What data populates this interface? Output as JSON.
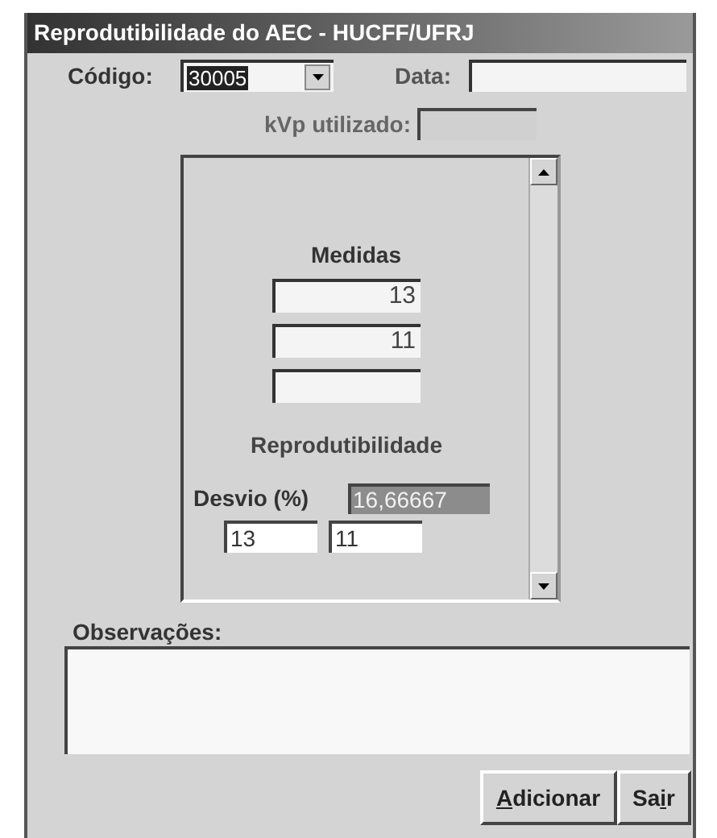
{
  "window": {
    "title": "Reprodutibilidade do AEC - HUCFF/UFRJ"
  },
  "codigo": {
    "label": "Código:",
    "value": "30005"
  },
  "data": {
    "label": "Data:"
  },
  "kvp": {
    "label": "kVp utilizado:",
    "disabled": true
  },
  "medidas": {
    "title": "Medidas",
    "values": [
      "13",
      "11"
    ]
  },
  "reprodutibilidade": {
    "title": "Reprodutibilidade",
    "desvio_label": "Desvio (%)",
    "desvio_value": "16,66667",
    "desvio_disabled": true,
    "pair": [
      "13",
      "11"
    ]
  },
  "observacoes": {
    "label": "Observações:"
  },
  "buttons": [
    {
      "label_parts": [
        {
          "text": "A",
          "underlined": true
        },
        {
          "text": "dicionar",
          "underlined": false
        }
      ]
    },
    {
      "label_parts": [
        {
          "text": "Sa",
          "underlined": false
        },
        {
          "text": "i",
          "underlined": true
        },
        {
          "text": "r",
          "underlined": false
        }
      ]
    }
  ]
}
